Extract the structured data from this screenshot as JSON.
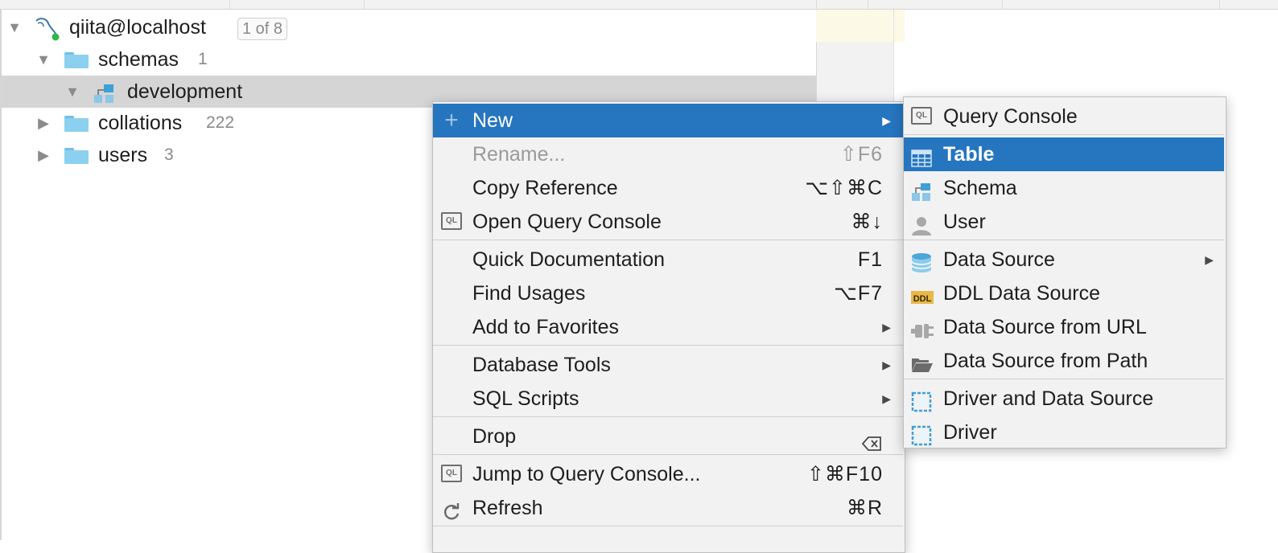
{
  "tree": {
    "root": {
      "label": "qiita@localhost",
      "badge": "1 of 8"
    },
    "schemas": {
      "label": "schemas",
      "count": "1"
    },
    "development": {
      "label": "development"
    },
    "collations": {
      "label": "collations",
      "count": "222"
    },
    "users": {
      "label": "users",
      "count": "3"
    }
  },
  "context_menu": {
    "items": [
      {
        "label": "New",
        "shortcut": "",
        "submenu": true,
        "active": true,
        "icon": "plus-icon"
      },
      {
        "label": "Rename...",
        "shortcut": "⇧F6",
        "disabled": true
      },
      {
        "label": "Copy Reference",
        "shortcut": "⌥⇧⌘C"
      },
      {
        "label": "Open Query Console",
        "shortcut": "⌘↓",
        "icon": "query-console-icon"
      },
      {
        "label": "Quick Documentation",
        "shortcut": "F1"
      },
      {
        "label": "Find Usages",
        "shortcut": "⌥F7"
      },
      {
        "label": "Add to Favorites",
        "submenu": true
      },
      {
        "label": "Database Tools",
        "submenu": true
      },
      {
        "label": "SQL Scripts",
        "submenu": true
      },
      {
        "label": "Drop",
        "icon": "delete-key-icon"
      },
      {
        "label": "Jump to Query Console...",
        "shortcut": "⇧⌘F10",
        "icon": "query-console-icon"
      },
      {
        "label": "Refresh",
        "shortcut": "⌘R",
        "icon": "refresh-icon"
      }
    ]
  },
  "submenu": {
    "items": [
      {
        "label": "Query Console",
        "icon": "query-console-icon"
      },
      {
        "label": "Table",
        "icon": "table-icon",
        "active": true
      },
      {
        "label": "Schema",
        "icon": "schema-icon"
      },
      {
        "label": "User",
        "icon": "user-icon"
      },
      {
        "label": "Data Source",
        "icon": "database-icon",
        "submenu": true
      },
      {
        "label": "DDL Data Source",
        "icon": "ddl-icon"
      },
      {
        "label": "Data Source from URL",
        "icon": "plug-icon"
      },
      {
        "label": "Data Source from Path",
        "icon": "folder-open-icon"
      },
      {
        "label": "Driver and Data Source",
        "icon": "driver-icon"
      },
      {
        "label": "Driver",
        "icon": "driver-icon"
      }
    ]
  },
  "colors": {
    "accent": "#2675bf",
    "folder": "#8cd0f0",
    "selection": "#d5d5d5"
  }
}
